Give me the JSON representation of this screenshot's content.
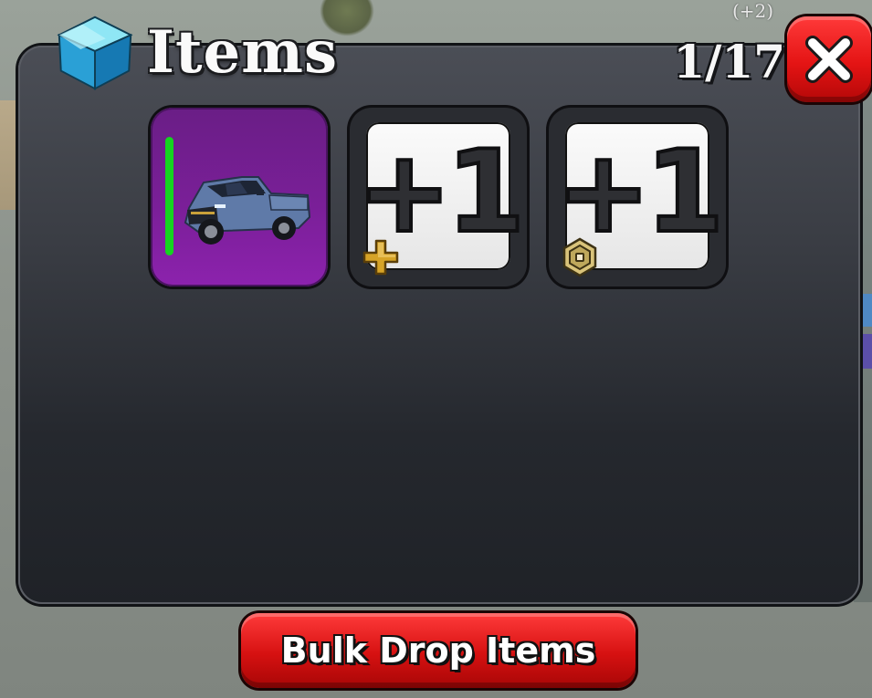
{
  "window": {
    "title": "Items",
    "counter": "1/17",
    "background_badge": "(+2)"
  },
  "icons": {
    "title_icon": "box-icon",
    "close_icon": "close-icon",
    "slot2_badge": "premium-plus-icon",
    "slot3_badge": "robux-coin-icon"
  },
  "items": [
    {
      "kind": "vehicle",
      "name": "pickup-truck",
      "rarity_color": "#15d420",
      "background": "#7a1f98"
    },
    {
      "kind": "placeholder",
      "label": "+1",
      "badge": "premium-plus-icon"
    },
    {
      "kind": "placeholder",
      "label": "+1",
      "badge": "robux-coin-icon"
    }
  ],
  "actions": {
    "bulk_drop_label": "Bulk Drop Items"
  },
  "colors": {
    "accent_red": "#e41414",
    "panel_top": "#4b4e56",
    "panel_bottom": "#1f2227"
  }
}
